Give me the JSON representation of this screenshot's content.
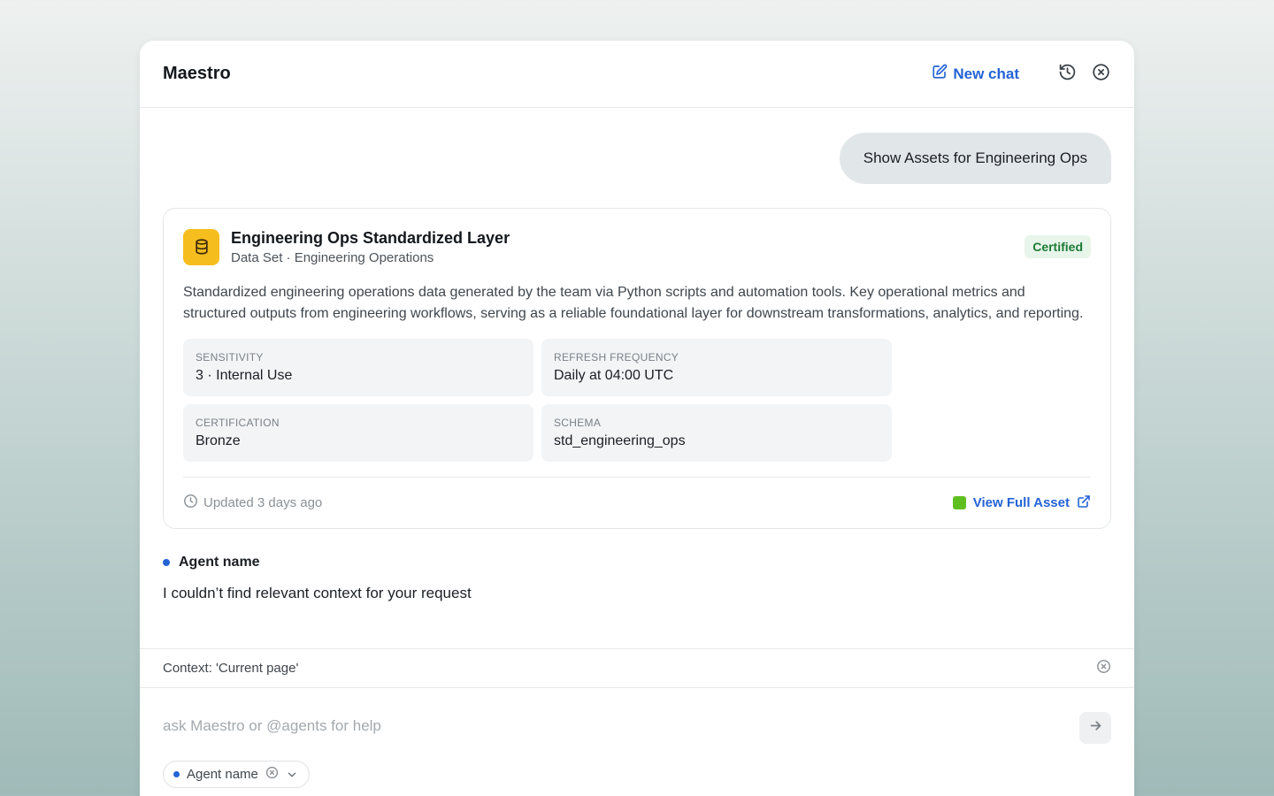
{
  "header": {
    "title": "Maestro",
    "new_chat_label": "New chat"
  },
  "user_message": "Show Assets for Engineering Ops",
  "asset": {
    "title": "Engineering Ops Standardized Layer",
    "subtitle": "Data Set · Engineering Operations",
    "badge": "Certified",
    "description": "Standardized engineering operations data generated by the team via Python scripts and automation tools. Key operational metrics and structured outputs from engineering workflows, serving as a reliable foundational layer for downstream transformations, analytics, and reporting.",
    "fields": [
      {
        "label": "Sensitivity",
        "value": "3 · Internal Use"
      },
      {
        "label": "Refresh Frequency",
        "value": "Daily at 04:00 UTC"
      },
      {
        "label": "Certification",
        "value": "Bronze"
      },
      {
        "label": "Schema",
        "value": "std_engineering_ops"
      }
    ],
    "updated": "Updated 3 days ago",
    "view_full_label": "View Full Asset"
  },
  "agent": {
    "name": "Agent name",
    "message": "I couldn’t find relevant context for your request"
  },
  "context": {
    "text": "Context: 'Current page'"
  },
  "composer": {
    "placeholder": "ask Maestro or @agents for help",
    "value": "",
    "agent_chip_label": "Agent name"
  },
  "colors": {
    "accent": "#2463d6",
    "certified_bg": "#e7f5ea",
    "certified_text": "#1e7a36",
    "db_icon_bg": "#f6bd1e",
    "asset_square": "#5fbf1f"
  },
  "icons": {
    "new_chat": "edit-icon",
    "history": "history-icon",
    "close": "close-circle-icon",
    "dataset": "database-icon",
    "clock": "clock-icon",
    "external": "external-link-icon",
    "send": "arrow-right-icon",
    "chevron": "chevron-down-icon"
  }
}
